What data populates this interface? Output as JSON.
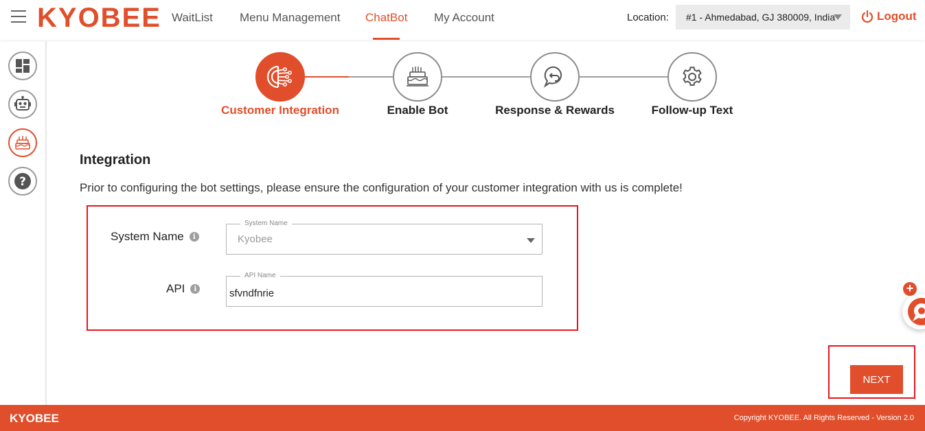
{
  "navbar": {
    "brand": "KYOBEE",
    "items": [
      {
        "label": "WaitList",
        "active": false
      },
      {
        "label": "Menu Management",
        "active": false
      },
      {
        "label": "ChatBot",
        "active": true
      },
      {
        "label": "My Account",
        "active": false
      }
    ],
    "location_label": "Location:",
    "location_value": "#1 - Ahmedabad, GJ 380009, India",
    "logout_label": "Logout"
  },
  "sidebar": {
    "items": [
      {
        "icon": "dashboard-icon",
        "active": false
      },
      {
        "icon": "robot-icon",
        "active": false
      },
      {
        "icon": "cake-icon",
        "active": true
      },
      {
        "icon": "help-icon",
        "active": false
      }
    ]
  },
  "stepper": {
    "steps": [
      {
        "label": "Customer Integration",
        "icon": "integration-icon",
        "active": true
      },
      {
        "label": "Enable Bot",
        "icon": "cake-icon",
        "active": false
      },
      {
        "label": "Response & Rewards",
        "icon": "reply-bubble-icon",
        "active": false
      },
      {
        "label": "Follow-up Text",
        "icon": "gear-icon",
        "active": false
      }
    ]
  },
  "integration": {
    "title": "Integration",
    "description": "Prior to configuring the bot settings, please ensure the configuration of your customer integration with us is complete!",
    "system_name": {
      "label": "System Name",
      "legend": "System Name",
      "value": "Kyobee",
      "disabled": true
    },
    "api": {
      "label": "API",
      "legend": "API Name",
      "value": "sfvndfnrie"
    }
  },
  "actions": {
    "next_label": "NEXT"
  },
  "footer": {
    "brand": "KYOBEE",
    "copyright": "Copyright KYOBEE. All Rights Reserved - Version 2.0"
  },
  "colors": {
    "accent": "#e04e2b",
    "highlight": "#e8141c",
    "muted": "#9e9e9e"
  }
}
